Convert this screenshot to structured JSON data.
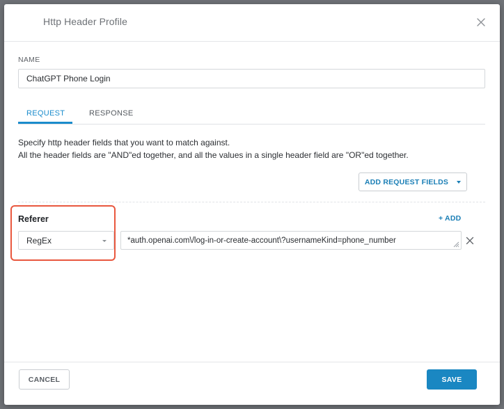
{
  "dialog": {
    "title": "Http Header Profile",
    "close_icon": "close-icon"
  },
  "name_field": {
    "label": "NAME",
    "value": "ChatGPT Phone Login"
  },
  "tabs": [
    {
      "label": "REQUEST",
      "active": true
    },
    {
      "label": "RESPONSE",
      "active": false
    }
  ],
  "description": {
    "line1": "Specify http header fields that you want to match against.",
    "line2": "All the header fields are \"AND\"ed together, and all the values in a single header field are \"OR\"ed together."
  },
  "add_request_fields": {
    "label": "ADD REQUEST FIELDS",
    "icon": "chevron-down-icon"
  },
  "header_field": {
    "name": "Referer",
    "add_label": "+ ADD",
    "match_type": "RegEx",
    "value": "*auth.openai.com\\/log-in-or-create-account\\?usernameKind=phone_number",
    "remove_icon": "close-icon"
  },
  "footer": {
    "cancel_label": "CANCEL",
    "save_label": "SAVE"
  },
  "colors": {
    "accent": "#1a87c2",
    "highlight": "#e9573e"
  }
}
